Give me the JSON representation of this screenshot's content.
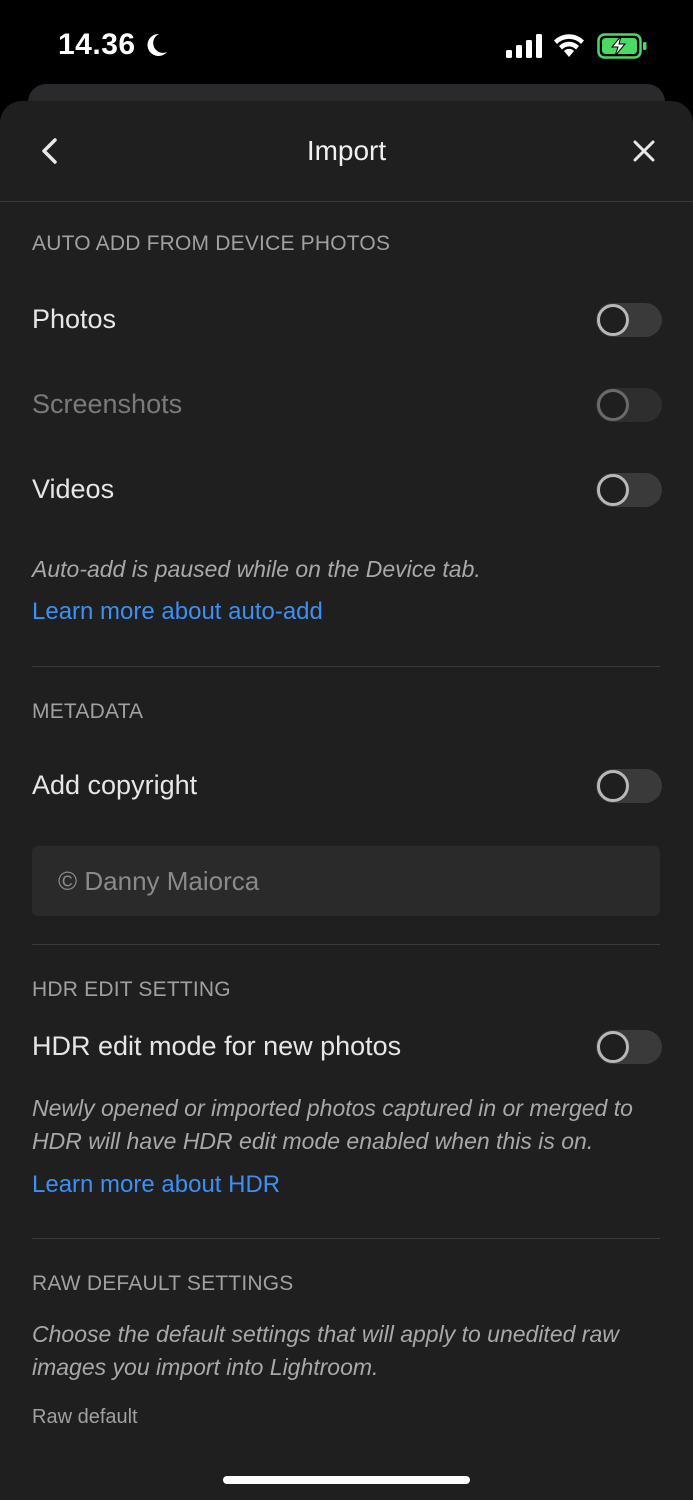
{
  "status": {
    "time": "14.36"
  },
  "header": {
    "title": "Import"
  },
  "auto_add": {
    "heading": "AUTO ADD FROM DEVICE PHOTOS",
    "photos_label": "Photos",
    "screenshots_label": "Screenshots",
    "videos_label": "Videos",
    "note": "Auto-add is paused while on the Device tab.",
    "link": "Learn more about auto-add"
  },
  "metadata": {
    "heading": "METADATA",
    "copyright_label": "Add copyright",
    "copyright_value": "© Danny Maiorca"
  },
  "hdr": {
    "heading": "HDR EDIT SETTING",
    "mode_label": "HDR edit mode for new photos",
    "note": "Newly opened or imported photos captured in or merged to HDR will have HDR edit mode enabled when this is on.",
    "link": "Learn more about HDR"
  },
  "raw": {
    "heading": "RAW DEFAULT SETTINGS",
    "note": "Choose the default settings that will apply to unedited raw images you import into Lightroom.",
    "default_label": "Raw default"
  },
  "colors": {
    "link": "#3b8ff5",
    "sheet_bg": "#1f1f1f",
    "battery_green": "#4cd964"
  }
}
